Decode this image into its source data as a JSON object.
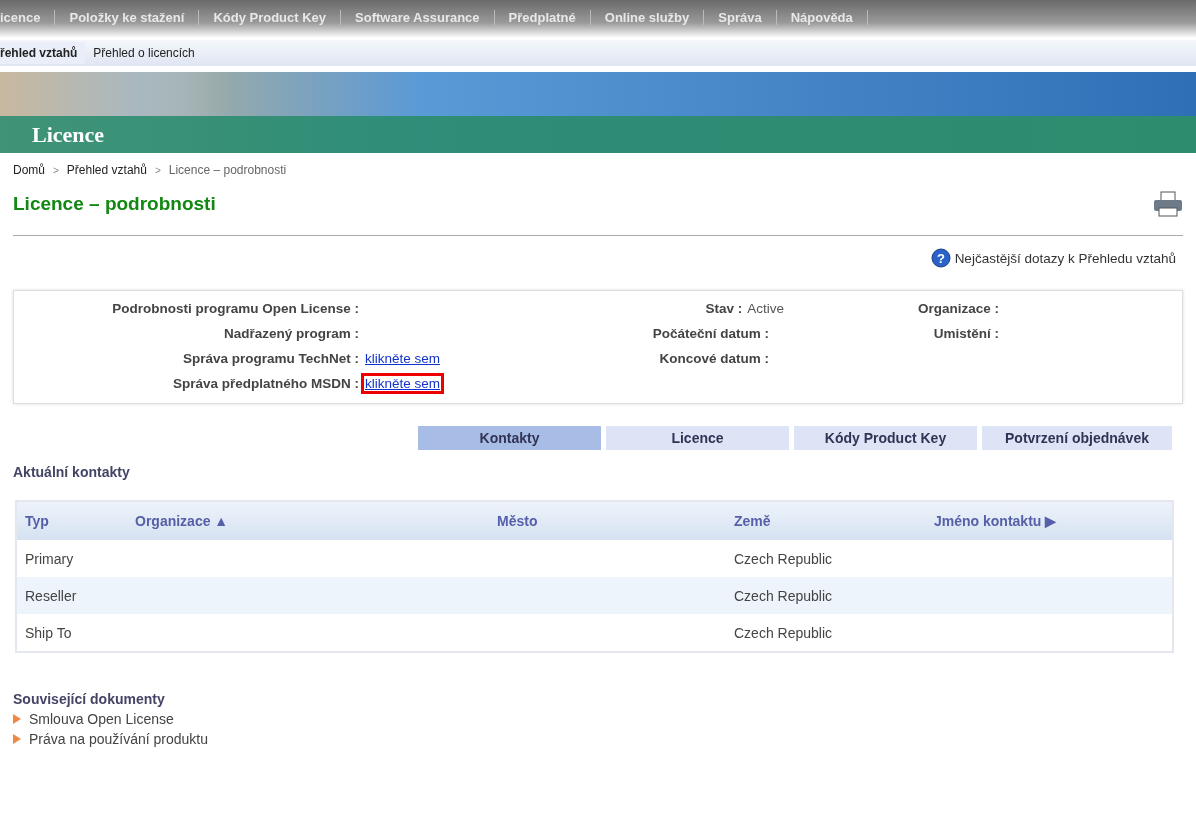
{
  "top_nav": [
    "icence",
    "Položky ke stažení",
    "Kódy Product Key",
    "Software Assurance",
    "Předplatné",
    "Online služby",
    "Správa",
    "Nápověda"
  ],
  "sub_nav": [
    {
      "label": "řehled vztahů",
      "selected": true
    },
    {
      "label": "Přehled o licencích",
      "selected": false
    }
  ],
  "banner": {
    "title": "Licence"
  },
  "breadcrumb": [
    "Domů",
    "Přehled vztahů",
    "Licence – podrobnosti"
  ],
  "breadcrumb_separator": ">",
  "page_title": "Licence – podrobnosti",
  "help_icon": "?",
  "help_link": "Nejčastější dotazy k Přehledu vztahů",
  "details_left": [
    {
      "label": "Podrobnosti programu Open License :"
    },
    {
      "label": "Nadřazený program :"
    },
    {
      "label": "Správa programu TechNet :",
      "link": "klikněte sem",
      "highlighted": false
    },
    {
      "label": "Správa předplatného MSDN :",
      "link": "klikněte sem",
      "highlighted": true
    }
  ],
  "details_middle": [
    {
      "label": "Stav :",
      "value": "Active"
    },
    {
      "label": "Počáteční datum :"
    },
    {
      "label": "Koncové datum :"
    }
  ],
  "details_right": [
    {
      "label": "Organizace :"
    },
    {
      "label": "Umistění :"
    }
  ],
  "tabs": [
    {
      "label": "Kontakty",
      "selected": true
    },
    {
      "label": "Licence",
      "selected": false
    },
    {
      "label": "Kódy Product Key",
      "selected": false
    },
    {
      "label": "Potvrzení objednávek",
      "selected": false
    }
  ],
  "contacts_title": "Aktuální kontakty",
  "table": {
    "columns": [
      {
        "label": "Typ"
      },
      {
        "label": "Organizace",
        "sort": "▲"
      },
      {
        "label": "Město"
      },
      {
        "label": "Země"
      },
      {
        "label": "Jméno kontaktu",
        "sort": "▶"
      }
    ],
    "rows": [
      {
        "cells": [
          "Primary",
          null,
          null,
          "Czech Republic",
          null
        ]
      },
      {
        "cells": [
          "Reseller",
          null,
          null,
          "Czech Republic",
          null
        ]
      },
      {
        "cells": [
          "Ship To",
          null,
          null,
          "Czech Republic",
          null
        ]
      }
    ]
  },
  "related_title": "Související dokumenty",
  "related_links": [
    "Smlouva Open License",
    "Práva na používání produktu"
  ]
}
